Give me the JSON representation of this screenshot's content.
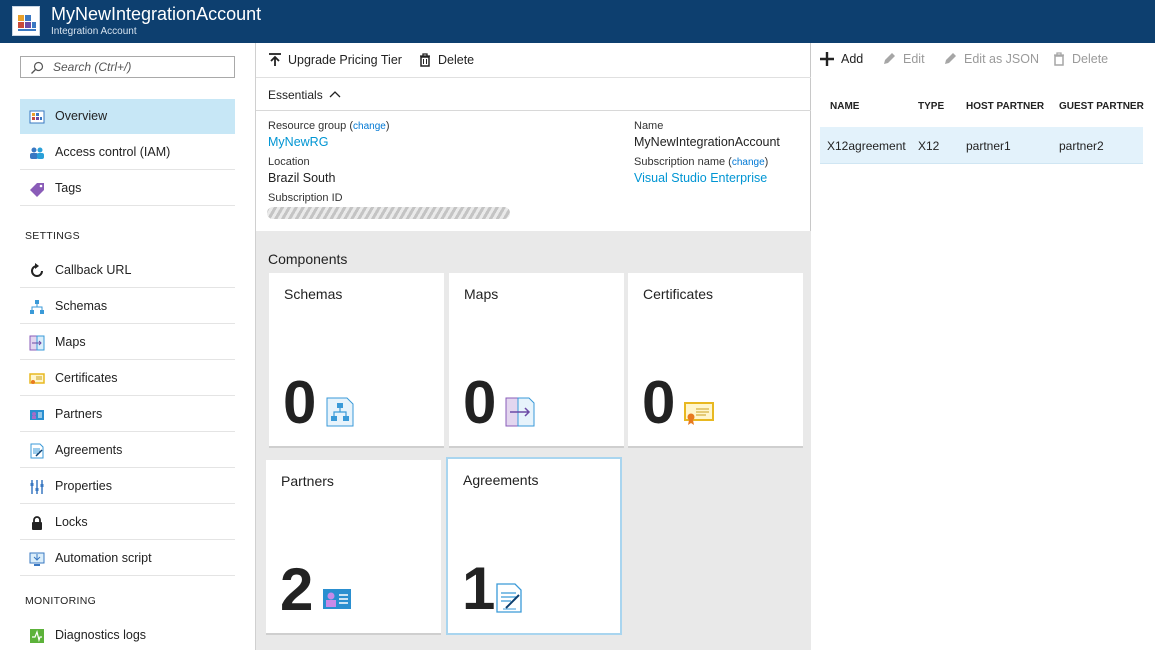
{
  "header": {
    "title": "MyNewIntegrationAccount",
    "subtitle": "Integration Account"
  },
  "sidebar": {
    "search_placeholder": "Search (Ctrl+/)",
    "items": [
      {
        "label": "Overview",
        "icon": "overview-icon",
        "active": true
      },
      {
        "label": "Access control (IAM)",
        "icon": "people-icon"
      },
      {
        "label": "Tags",
        "icon": "tag-icon"
      }
    ],
    "settings_heading": "SETTINGS",
    "settings": [
      {
        "label": "Callback URL",
        "icon": "refresh-icon"
      },
      {
        "label": "Schemas",
        "icon": "schema-icon"
      },
      {
        "label": "Maps",
        "icon": "map-icon"
      },
      {
        "label": "Certificates",
        "icon": "certificate-icon"
      },
      {
        "label": "Partners",
        "icon": "partner-icon"
      },
      {
        "label": "Agreements",
        "icon": "agreement-icon"
      },
      {
        "label": "Properties",
        "icon": "properties-icon"
      },
      {
        "label": "Locks",
        "icon": "lock-icon"
      },
      {
        "label": "Automation script",
        "icon": "download-icon"
      }
    ],
    "monitoring_heading": "MONITORING",
    "monitoring": [
      {
        "label": "Diagnostics logs",
        "icon": "diagnostics-icon"
      }
    ]
  },
  "toolbar": {
    "upgrade_label": "Upgrade Pricing Tier",
    "delete_label": "Delete"
  },
  "essentials": {
    "label": "Essentials",
    "resource_group_label": "Resource group",
    "change_label": "change",
    "resource_group_value": "MyNewRG",
    "location_label": "Location",
    "location_value": "Brazil South",
    "subscription_id_label": "Subscription ID",
    "name_label": "Name",
    "name_value": "MyNewIntegrationAccount",
    "subscription_name_label": "Subscription name",
    "subscription_name_value": "Visual Studio Enterprise"
  },
  "components": {
    "heading": "Components",
    "tiles": [
      {
        "label": "Schemas",
        "count": "0",
        "icon": "schema-icon"
      },
      {
        "label": "Maps",
        "count": "0",
        "icon": "map-icon"
      },
      {
        "label": "Certificates",
        "count": "0",
        "icon": "certificate-icon"
      },
      {
        "label": "Partners",
        "count": "2",
        "icon": "partner-icon"
      },
      {
        "label": "Agreements",
        "count": "1",
        "icon": "agreement-icon"
      }
    ]
  },
  "agreements_pane": {
    "toolbar": {
      "add_label": "Add",
      "edit_label": "Edit",
      "edit_json_label": "Edit as JSON",
      "delete_label": "Delete"
    },
    "columns": [
      "NAME",
      "TYPE",
      "HOST PARTNER",
      "GUEST PARTNER"
    ],
    "rows": [
      {
        "name": "X12agreement",
        "type": "X12",
        "host": "partner1",
        "guest": "partner2"
      }
    ]
  },
  "colors": {
    "titlebar": "#0d3f6f",
    "accent": "#0095d3",
    "selected_nav": "#c7e7f6",
    "components_bg": "#e9e9e9"
  }
}
